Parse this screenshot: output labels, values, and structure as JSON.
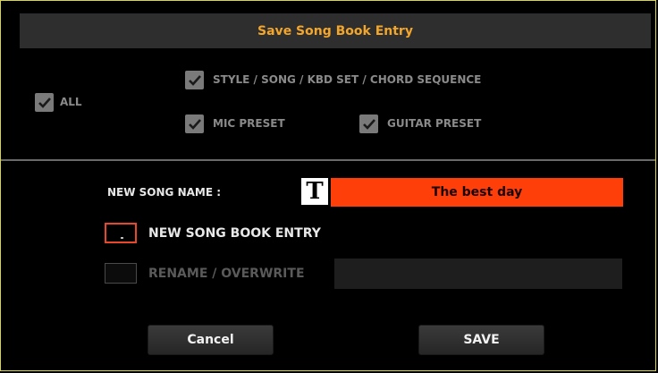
{
  "dialog": {
    "title": "Save Song Book Entry"
  },
  "options": {
    "all": {
      "label": "ALL",
      "checked": true
    },
    "style_song": {
      "label": "STYLE / SONG / KBD SET / CHORD SEQUENCE",
      "checked": true
    },
    "mic_preset": {
      "label": "MIC PRESET",
      "checked": true
    },
    "guitar_preset": {
      "label": "GUITAR PRESET",
      "checked": true
    }
  },
  "name": {
    "label": "NEW SONG NAME :",
    "edit_icon": "T",
    "value": "The best day"
  },
  "mode": {
    "new_entry_label": "NEW SONG BOOK ENTRY",
    "rename_label": "RENAME / OVERWRITE",
    "selected": "new_entry",
    "rename_value": ""
  },
  "buttons": {
    "cancel": "Cancel",
    "save": "SAVE"
  },
  "colors": {
    "accent_title": "#f2a62b",
    "name_field": "#ff3f0a",
    "selected_radio_border": "#e8482a",
    "frame_border": "#d9d642"
  }
}
